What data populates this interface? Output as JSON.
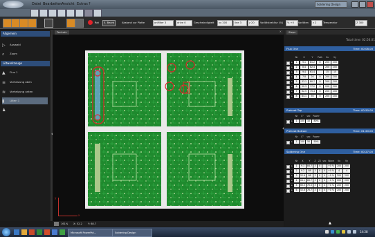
{
  "menu": [
    "Datei",
    "Bearbeiten",
    "Ansicht",
    "Extras",
    "?"
  ],
  "app_title": "Soldering Design",
  "toolbar": {
    "rot_label": "Rot",
    "mode_value": "5. Bearb",
    "distance_label": "Abstand zur Platte",
    "distance_value": "onMiter 3",
    "drive_value": "drive 0",
    "speed_label": "Geschwindigkeit",
    "xy_value": "xy 200",
    "line_value": "line 3",
    "z_value": "z 20",
    "solder_label": "Vorlötstrahltur (%)",
    "solder_value": "% +0",
    "height_label": "Vorlöten",
    "height_value": "z 2",
    "temp_label": "Temperatur",
    "temp_value": "Z 300"
  },
  "left_panel": {
    "general_header": "Allgemein",
    "tools": [
      {
        "label": "Auswahl",
        "icon": "cursor-icon"
      },
      {
        "label": "Zoom",
        "icon": "zoom-icon"
      }
    ],
    "solder_header": "Lötwerkzeuge",
    "items": [
      {
        "label": "Flux 1",
        "icon": "flux-icon"
      },
      {
        "label": "Vorheizung oben",
        "icon": "heater-top-icon"
      },
      {
        "label": "Vorheizung unten",
        "icon": "heater-bottom-icon"
      },
      {
        "label": "Löten 1",
        "icon": "solder-icon"
      }
    ]
  },
  "canvas": {
    "tab_label": "Test.sdv",
    "zoom": "161%",
    "x_value": "X: 52.2",
    "y_value": "Y: 68.7",
    "axis_y": "y",
    "axis_x": "x"
  },
  "right_panel": {
    "tab_label": "Steps",
    "total_time": "Total time: 02:56.01",
    "flux": {
      "title": "Flux One",
      "time": "Time: 00:08.00",
      "headers": [
        "Nr",
        "X",
        "Y",
        "Path",
        "Vx",
        "Vy"
      ],
      "rows": [
        [
          "1",
          "9.1",
          "81.2",
          "0",
          "200",
          "200"
        ],
        [
          "2",
          "8.4",
          "82.4",
          "",
          "200",
          "200"
        ],
        [
          "3",
          "9.4",
          "61.4",
          "",
          "15",
          "15"
        ],
        [
          "4",
          "7.8",
          "20",
          "0",
          "200",
          "200"
        ],
        [
          "5",
          "33.1",
          "80.7",
          "0",
          "200",
          "200"
        ],
        [
          "6",
          "52.3",
          "77.2",
          "0",
          "200",
          "200"
        ],
        [
          "7",
          "62.5",
          "75.4",
          "0",
          "200",
          "200"
        ],
        [
          "8",
          "84.1",
          "50",
          "0",
          "200",
          "200"
        ]
      ]
    },
    "preheat_top": {
      "title": "Preheat Top",
      "time": "Time: 00:50.00",
      "headers": [
        "Nr",
        "C°",
        "sec",
        "Power"
      ],
      "rows": [
        [
          "1",
          "100",
          "10",
          "80%"
        ]
      ]
    },
    "preheat_bottom": {
      "title": "Preheat Bottom",
      "time": "Time: 01:20.00",
      "headers": [
        "Nr",
        "C°",
        "sec",
        "Power"
      ],
      "rows": [
        [
          "1",
          "100",
          "50",
          "90%"
        ]
      ]
    },
    "soldering": {
      "title": "Soldering One",
      "time": "Time: 00:27.00",
      "headers": [
        "Nr",
        "X",
        "Y",
        "Z",
        "Z2",
        "sec",
        "Wave",
        "Vx",
        "Vy"
      ],
      "rows": [
        [
          "1",
          "9.1",
          "84.7",
          "3",
          "0",
          "",
          "+0 %",
          "200",
          "200"
        ],
        [
          "2",
          "9.2",
          "88",
          "3",
          "0",
          "0",
          "+0 %",
          "4",
          "4"
        ],
        [
          "3",
          "52.6",
          "88",
          "3",
          "0",
          "0",
          "+0 %",
          "200",
          "200"
        ],
        [
          "4",
          "64.1",
          "89.7",
          "3",
          "0",
          "0",
          "+0 %",
          "200",
          "200"
        ],
        [
          "5",
          "65.5",
          "75.5",
          "3",
          "0",
          "0",
          "+0 %",
          "200",
          "200"
        ],
        [
          "6",
          "52.6",
          "76.7",
          "3",
          "0",
          "0",
          "+0 %",
          "200",
          "200"
        ]
      ]
    }
  },
  "taskbar": {
    "items": [
      "Microsoft PowerPoi...",
      "Soldering Design"
    ],
    "clock": "14:28"
  }
}
